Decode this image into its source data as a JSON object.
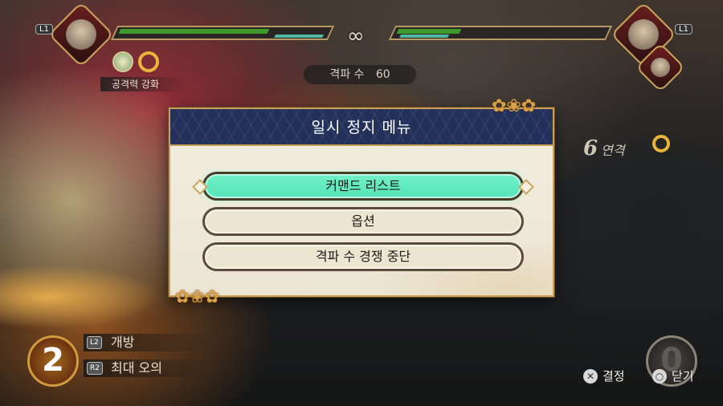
{
  "hud": {
    "left_button": "L1",
    "right_button": "L1",
    "infinity_symbol": "∞",
    "skill_buff_label": "공격력 강화",
    "counter_label": "격파 수",
    "counter_value": "60",
    "combo_count": "6",
    "combo_label": "연격",
    "player_health_fraction": 0.95,
    "enemy_health_fraction": 0.3,
    "colors": {
      "health": "#3a8f2a",
      "skill": "#4fb7a2",
      "accent": "#c9a05a"
    }
  },
  "bottom_hud": {
    "left_gauge_value": "2",
    "right_gauge_value": "0",
    "skill_1_button": "L2",
    "skill_1_label": "개방",
    "skill_2_button": "R2",
    "skill_2_label": "최대 오의",
    "confirm_glyph": "✕",
    "confirm_label": "결정",
    "close_glyph": "○",
    "close_label": "닫기"
  },
  "pause_menu": {
    "title": "일시 정지 메뉴",
    "items": [
      {
        "label": "커맨드 리스트",
        "selected": true
      },
      {
        "label": "옵션",
        "selected": false
      },
      {
        "label": "격파 수 경쟁 중단",
        "selected": false
      }
    ],
    "colors": {
      "header": "#22305a",
      "selected": "#5ee8bc",
      "panel": "#efe8d8"
    }
  }
}
